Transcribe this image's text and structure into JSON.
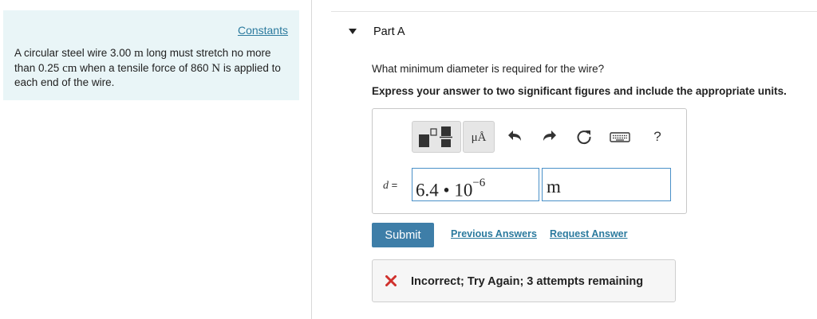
{
  "left_panel": {
    "constants_link": "Constants",
    "problem": {
      "t1": "A circular steel wire 3.00 ",
      "u1": "m",
      "t2": " long must stretch no more than 0.25 ",
      "u2": "cm",
      "t3": " when a tensile force of 860 ",
      "u3": "N",
      "t4": " is applied to each end of the wire."
    }
  },
  "part": {
    "title": "Part A",
    "question": "What minimum diameter is required for the wire?",
    "instruction": "Express your answer to two significant figures and include the appropriate units."
  },
  "toolbar": {
    "units_label": "μÅ",
    "help_label": "?",
    "icons": [
      "templates-icon",
      "units-icon",
      "undo-icon",
      "redo-icon",
      "reset-icon",
      "keyboard-icon",
      "help-icon"
    ]
  },
  "answer": {
    "variable": "d",
    "equals": "=",
    "mantissa": "6.4",
    "times": "•",
    "base": "10",
    "exponent": "−6",
    "unit": "m"
  },
  "actions": {
    "submit_label": "Submit",
    "previous_answers": "Previous Answers",
    "request_answer": "Request Answer"
  },
  "feedback": {
    "message": "Incorrect; Try Again; 3 attempts remaining",
    "status_color": "#d0312d"
  },
  "colors": {
    "link": "#2b7a9e",
    "submit_bg": "#3e7ea8",
    "panel_bg": "#e9f5f7",
    "input_border": "#4a90c8"
  }
}
